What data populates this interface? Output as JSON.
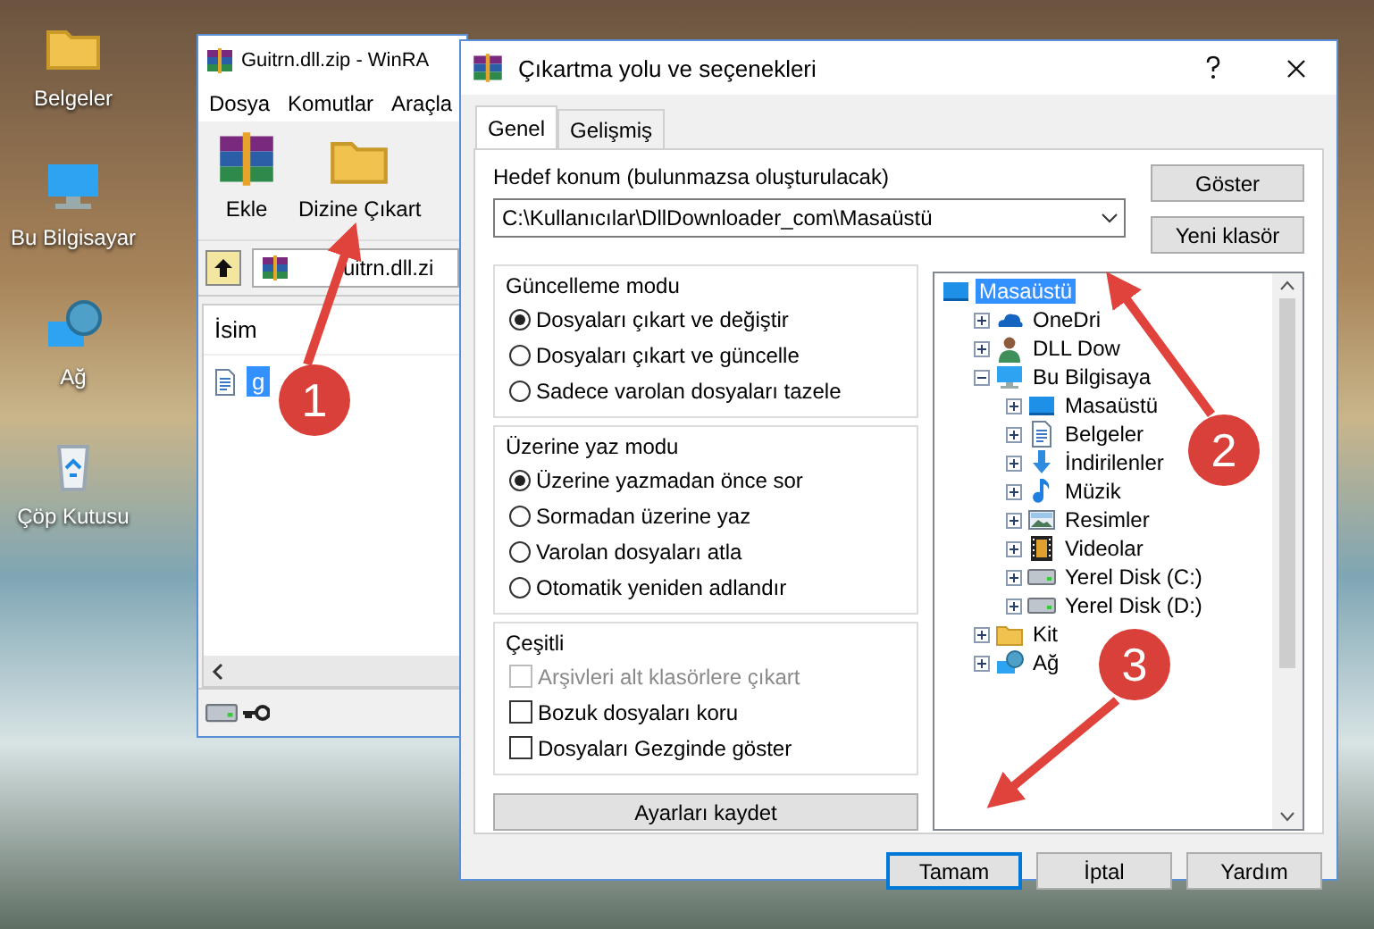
{
  "desktop": {
    "icons": [
      {
        "label": "Belgeler",
        "kind": "user-folder"
      },
      {
        "label": "Bu Bilgisayar",
        "kind": "computer"
      },
      {
        "label": "Ağ",
        "kind": "network"
      },
      {
        "label": "Çöp Kutusu",
        "kind": "recycle"
      }
    ]
  },
  "winrar": {
    "title": "Guitrn.dll.zip - WinRA",
    "menu": [
      "Dosya",
      "Komutlar",
      "Araçla"
    ],
    "toolbar": [
      {
        "label": "Ekle",
        "kind": "add"
      },
      {
        "label": "Dizine Çıkart",
        "kind": "extract"
      }
    ],
    "address": "uitrn.dll.zi",
    "columns": [
      "İsim"
    ],
    "rows": [
      {
        "name": "g",
        "selected": true
      }
    ]
  },
  "dialog": {
    "title": "Çıkartma yolu ve seçenekleri",
    "tabs": [
      {
        "label": "Genel",
        "selected": true
      },
      {
        "label": "Gelişmiş",
        "selected": false
      }
    ],
    "destination": {
      "label": "Hedef konum (bulunmazsa oluşturulacak)",
      "value": "C:\\Kullanıcılar\\DllDownloader_com\\Masaüstü"
    },
    "side_buttons": [
      "Göster",
      "Yeni klasör"
    ],
    "update_mode": {
      "title": "Güncelleme modu",
      "options": [
        {
          "label": "Dosyaları çıkart ve değiştir",
          "selected": true
        },
        {
          "label": "Dosyaları çıkart ve güncelle",
          "selected": false
        },
        {
          "label": "Sadece varolan dosyaları tazele",
          "selected": false
        }
      ]
    },
    "overwrite_mode": {
      "title": "Üzerine yaz modu",
      "options": [
        {
          "label": "Üzerine yazmadan önce sor",
          "selected": true
        },
        {
          "label": "Sormadan üzerine yaz",
          "selected": false
        },
        {
          "label": "Varolan dosyaları atla",
          "selected": false
        },
        {
          "label": "Otomatik yeniden adlandır",
          "selected": false
        }
      ]
    },
    "misc": {
      "title": "Çeşitli",
      "options": [
        {
          "label": "Arşivleri alt klasörlere çıkart",
          "checked": false,
          "disabled": true
        },
        {
          "label": "Bozuk dosyaları koru",
          "checked": false,
          "disabled": false
        },
        {
          "label": "Dosyaları Gezginde göster",
          "checked": false,
          "disabled": false
        }
      ]
    },
    "save_button": "Ayarları kaydet",
    "tree": {
      "items": [
        {
          "label": "Masaüstü",
          "kind": "desktop",
          "selected": true,
          "children": [
            {
              "label": "OneDri",
              "kind": "cloud",
              "selected": false,
              "expanded": false
            },
            {
              "label": "DLL Dow",
              "kind": "user",
              "selected": false,
              "expanded": false
            },
            {
              "label": "Bu Bilgisaya",
              "kind": "computer",
              "selected": false,
              "expanded": true,
              "children": [
                {
                  "label": "Masaüstü",
                  "kind": "desktop",
                  "selected": false,
                  "expanded": false
                },
                {
                  "label": "Belgeler",
                  "kind": "docs",
                  "selected": false,
                  "expanded": false
                },
                {
                  "label": "İndirilenler",
                  "kind": "download",
                  "selected": false,
                  "expanded": false
                },
                {
                  "label": "Müzik",
                  "kind": "music",
                  "selected": false,
                  "expanded": false
                },
                {
                  "label": "Resimler",
                  "kind": "pictures",
                  "selected": false,
                  "expanded": false
                },
                {
                  "label": "Videolar",
                  "kind": "video",
                  "selected": false,
                  "expanded": false
                },
                {
                  "label": "Yerel Disk (C:)",
                  "kind": "disk",
                  "selected": false,
                  "expanded": false
                },
                {
                  "label": "Yerel Disk (D:)",
                  "kind": "disk",
                  "selected": false,
                  "expanded": false
                }
              ]
            },
            {
              "label": "Kit",
              "kind": "library",
              "selected": false,
              "expanded": false
            },
            {
              "label": "Ağ",
              "kind": "network",
              "selected": false,
              "expanded": false
            }
          ]
        }
      ]
    },
    "buttons": [
      {
        "label": "Tamam",
        "focused": true
      },
      {
        "label": "İptal",
        "focused": false
      },
      {
        "label": "Yardım",
        "focused": false
      }
    ]
  },
  "annotations": [
    {
      "number": "1"
    },
    {
      "number": "2"
    },
    {
      "number": "3"
    }
  ]
}
